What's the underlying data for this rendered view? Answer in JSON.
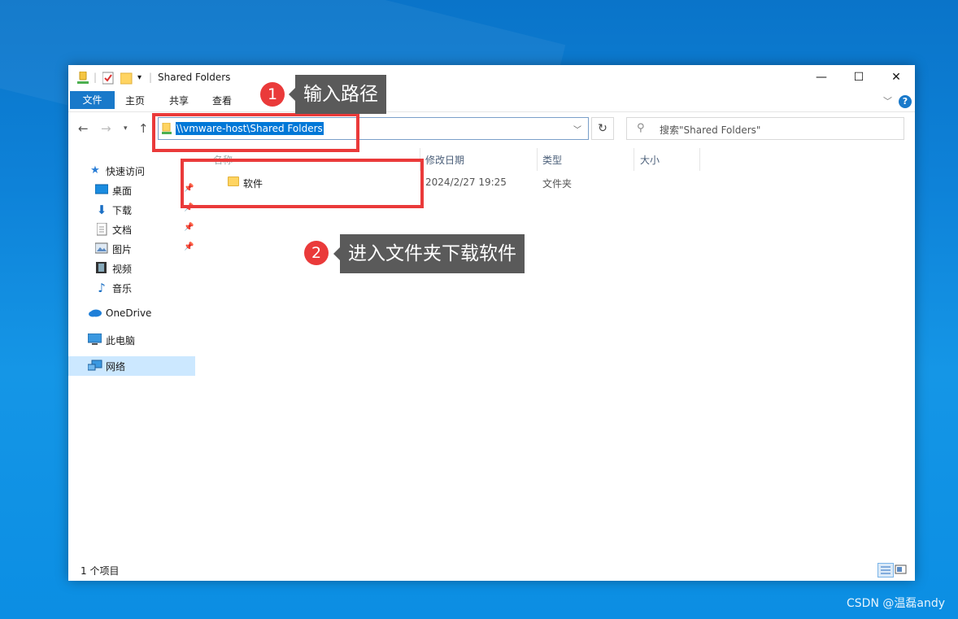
{
  "window": {
    "title": "Shared Folders",
    "controls": {
      "minimize": "—",
      "maximize": "☐",
      "close": "✕"
    }
  },
  "ribbon": {
    "tabs": [
      "文件",
      "主页",
      "共享",
      "查看"
    ],
    "help": "?"
  },
  "nav": {
    "address": "\\\\vmware-host\\Shared Folders",
    "search_placeholder": "搜索\"Shared Folders\""
  },
  "sidebar": {
    "items": [
      {
        "label": "快速访问",
        "icon": "star-icon"
      },
      {
        "label": "桌面",
        "icon": "desktop-icon",
        "pinned": true
      },
      {
        "label": "下载",
        "icon": "download-icon",
        "pinned": true
      },
      {
        "label": "文档",
        "icon": "document-icon",
        "pinned": true
      },
      {
        "label": "图片",
        "icon": "picture-icon",
        "pinned": true
      },
      {
        "label": "视频",
        "icon": "video-icon"
      },
      {
        "label": "音乐",
        "icon": "music-icon"
      },
      {
        "label": "OneDrive",
        "icon": "cloud-icon"
      },
      {
        "label": "此电脑",
        "icon": "computer-icon"
      },
      {
        "label": "网络",
        "icon": "network-icon",
        "selected": true
      }
    ]
  },
  "columns": [
    "名称",
    "修改日期",
    "类型",
    "大小"
  ],
  "files": [
    {
      "name": "软件",
      "modified": "2024/2/27 19:25",
      "type": "文件夹",
      "size": ""
    }
  ],
  "status": {
    "count": "1 个项目"
  },
  "annotations": [
    {
      "number": "1",
      "text": "输入路径"
    },
    {
      "number": "2",
      "text": "进入文件夹下载软件"
    }
  ],
  "watermark": "CSDN @温磊andy",
  "colors": {
    "accent": "#1979ca",
    "highlight": "#ea3a3a",
    "selection": "#0078d7"
  }
}
